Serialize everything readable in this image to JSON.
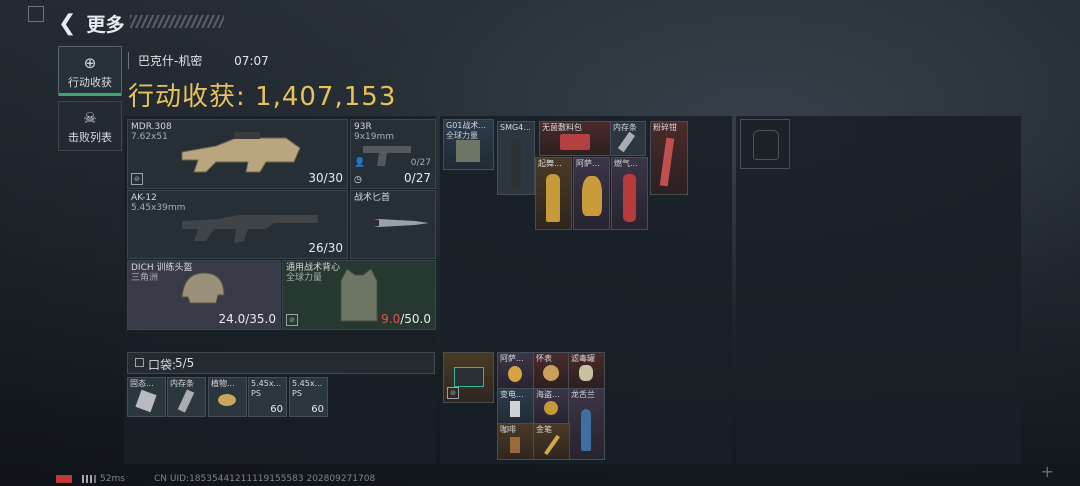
{
  "header": {
    "back_label": "更多"
  },
  "tabs": [
    {
      "label": "行动收获",
      "icon": "target-icon",
      "active": true
    },
    {
      "label": "击败列表",
      "icon": "skull-icon",
      "active": false
    }
  ],
  "match": {
    "map": "巴克什-机密",
    "time": "07:07"
  },
  "harvest": {
    "label": "行动收获:",
    "value": "1,407,153"
  },
  "weapons": [
    {
      "name": "MDR.308",
      "sub": "7.62x51",
      "value": "30/30"
    },
    {
      "name": "93R",
      "sub": "9x19mm",
      "ammo_small": "0/27",
      "value": "0/27"
    },
    {
      "name": "AK-12",
      "sub": "5.45x39mm",
      "value": "26/30"
    },
    {
      "name": "战术匕首",
      "sub": ""
    }
  ],
  "armor": [
    {
      "name": "DICH 训练头盔",
      "sub": "三角洲",
      "value": "24.0/35.0"
    },
    {
      "name": "通用战术背心",
      "sub": "全球力量",
      "value_damaged": "9.0",
      "value_max": "/50.0"
    }
  ],
  "pocket": {
    "label": "口袋:",
    "count": "5/5"
  },
  "pocket_items": [
    {
      "name": "固态..."
    },
    {
      "name": "内存条"
    },
    {
      "name": "植物..."
    },
    {
      "name": "5.45x...",
      "sub": "PS",
      "count": "60"
    },
    {
      "name": "5.45x...",
      "sub": "PS",
      "count": "60"
    }
  ],
  "chest_items": [
    {
      "name": "G01战术...",
      "sub": "全球力量"
    },
    {
      "name": "SMG4..."
    },
    {
      "name": "无菌敷料包"
    },
    {
      "name": "内存条"
    },
    {
      "name": "粉碎钳"
    },
    {
      "name": "起舞..."
    },
    {
      "name": "阿萨..."
    },
    {
      "name": "燃气..."
    }
  ],
  "backpack_items": [
    {
      "name": "阿萨..."
    },
    {
      "name": "怀表"
    },
    {
      "name": "滤毒罐"
    },
    {
      "name": "变电..."
    },
    {
      "name": "海盗..."
    },
    {
      "name": "龙舌兰"
    },
    {
      "name": "咖啡"
    },
    {
      "name": "金笔"
    }
  ],
  "footer": {
    "ping": "52ms",
    "uid": "CN UID:18535441211119155583 202809271708"
  },
  "colors": {
    "accent_green": "#3ba86e",
    "gold": "#e8c15b",
    "damaged_red": "#e05252"
  }
}
